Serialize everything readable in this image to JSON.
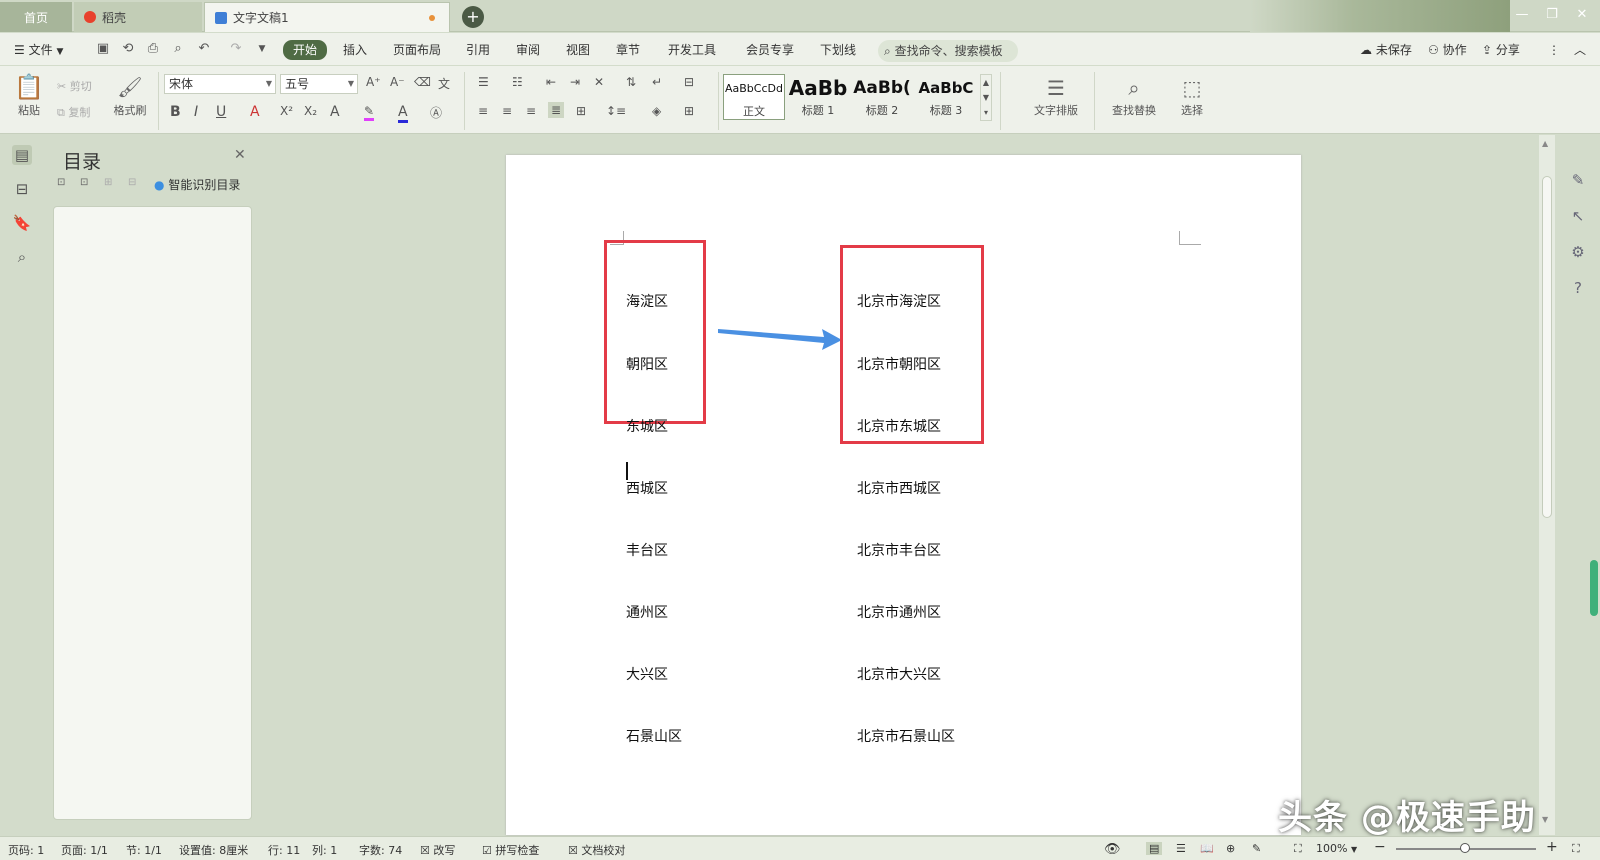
{
  "tabs": {
    "home": "首页",
    "daoke": "稻壳",
    "doc": "文字文稿1"
  },
  "menu": {
    "file": "文件",
    "items": [
      "开始",
      "插入",
      "页面布局",
      "引用",
      "审阅",
      "视图",
      "章节",
      "开发工具",
      "会员专享",
      "下划线"
    ],
    "search_placeholder": "查找命令、搜索模板",
    "unsaved": "未保存",
    "collab": "协作",
    "share": "分享"
  },
  "ribbon": {
    "paste": "粘贴",
    "cut": "剪切",
    "copy": "复制",
    "format_painter": "格式刷",
    "font": "宋体",
    "size": "五号",
    "styles": [
      {
        "preview": "AaBbCcDd",
        "label": "正文"
      },
      {
        "preview": "AaBb",
        "label": "标题 1"
      },
      {
        "preview": "AaBb(",
        "label": "标题 2"
      },
      {
        "preview": "AaBbC",
        "label": "标题 3"
      }
    ],
    "text_layout": "文字排版",
    "find_replace": "查找替换",
    "select": "选择"
  },
  "toc": {
    "title": "目录",
    "smart": "智能识别目录"
  },
  "document": {
    "left_list": [
      "海淀区",
      "朝阳区",
      "东城区",
      "西城区",
      "丰台区",
      "通州区",
      "大兴区",
      "石景山区"
    ],
    "right_list": [
      "北京市海淀区",
      "北京市朝阳区",
      "北京市东城区",
      "北京市西城区",
      "北京市丰台区",
      "北京市通州区",
      "北京市大兴区",
      "北京市石景山区"
    ]
  },
  "status": {
    "page": "页码: 1",
    "pages": "页面: 1/1",
    "section": "节: 1/1",
    "setting": "设置值: 8厘米",
    "row": "行: 11",
    "col": "列: 1",
    "words": "字数: 74",
    "revise": "改写",
    "spell": "拼写检查",
    "proof": "文档校对",
    "zoom": "100%"
  },
  "watermark": "头条 @极速手助",
  "colors": {
    "accent": "#4f6b44",
    "box_red": "#e33b47",
    "arrow_blue": "#4a90e2"
  }
}
